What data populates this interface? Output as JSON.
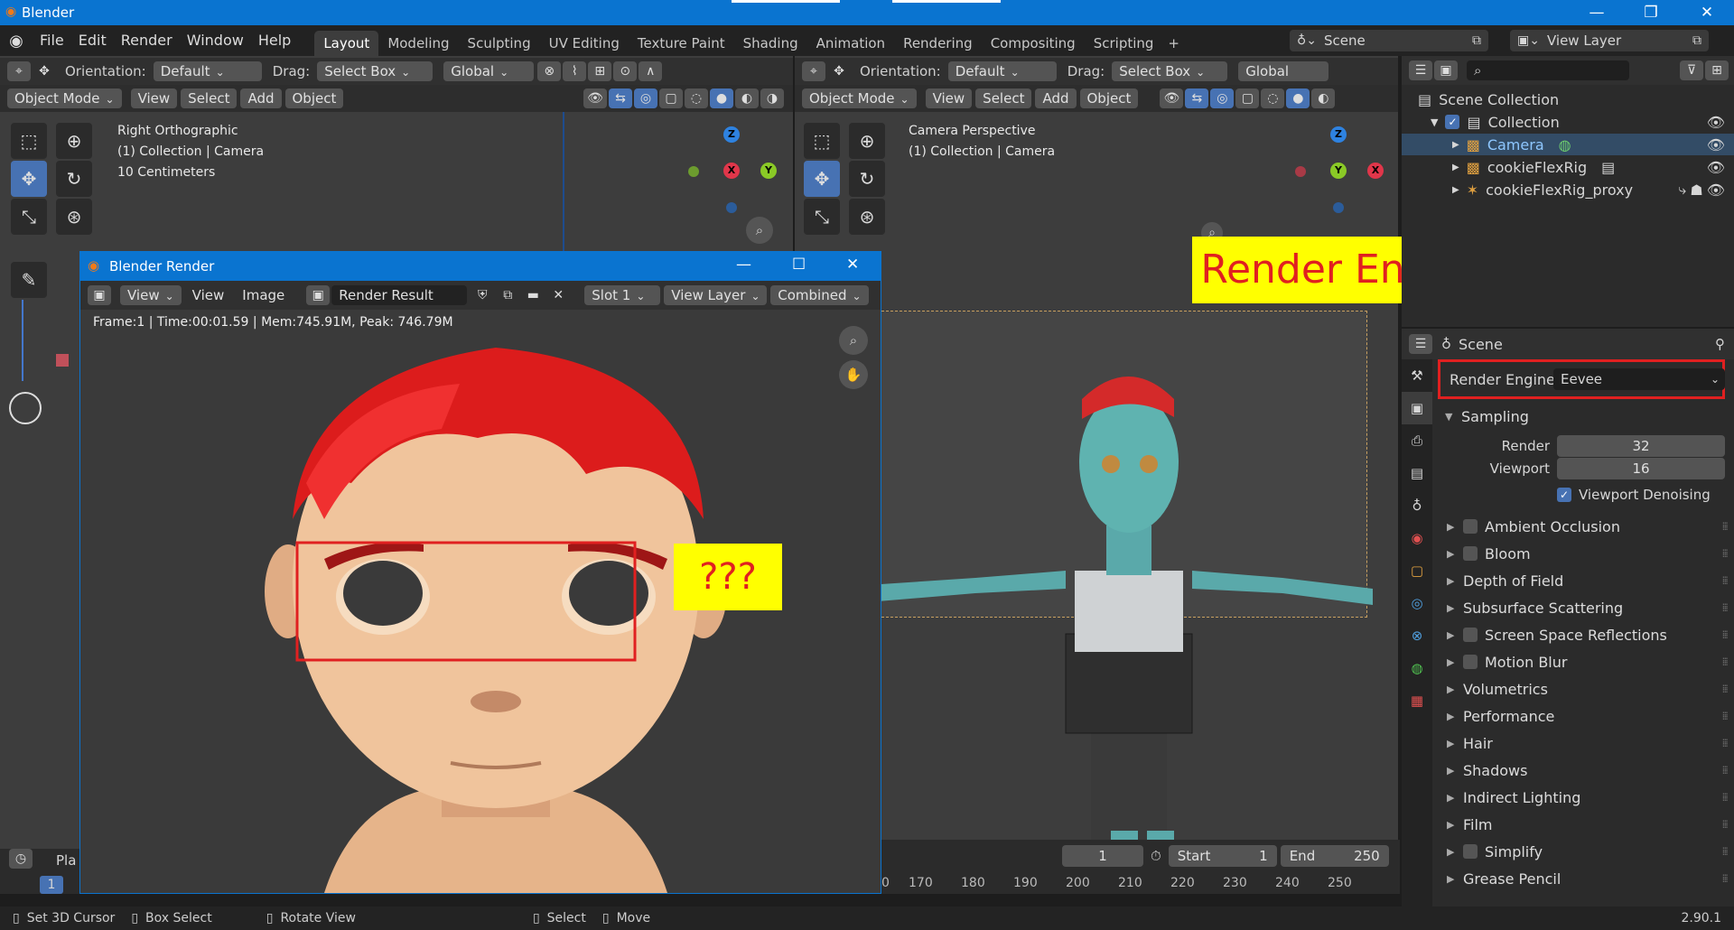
{
  "app": {
    "title": "Blender",
    "version": "2.90.1"
  },
  "menu": [
    "File",
    "Edit",
    "Render",
    "Window",
    "Help"
  ],
  "workspaces": [
    "Layout",
    "Modeling",
    "Sculpting",
    "UV Editing",
    "Texture Paint",
    "Shading",
    "Animation",
    "Rendering",
    "Compositing",
    "Scripting"
  ],
  "top_right": {
    "scene": "Scene",
    "view_layer": "View Layer"
  },
  "viewport_header": {
    "orientation_label": "Orientation:",
    "orientation_value": "Default",
    "drag_label": "Drag:",
    "drag_value": "Select Box",
    "transform": "Global",
    "mode": "Object Mode",
    "menus": [
      "View",
      "Select",
      "Add",
      "Object"
    ]
  },
  "left_viewport": {
    "lines": [
      "Right Orthographic",
      "(1) Collection | Camera",
      "10 Centimeters"
    ]
  },
  "right_viewport": {
    "lines": [
      "Camera Perspective",
      "(1) Collection | Camera"
    ]
  },
  "annotation_engine": "Render Engine: Eevee",
  "annotation_question": "???",
  "render_window": {
    "title": "Blender Render",
    "menus": [
      "View",
      "View",
      "Image"
    ],
    "image_name": "Render Result",
    "slot": "Slot 1",
    "layer": "View Layer",
    "pass": "Combined",
    "info": "Frame:1 | Time:00:01.59 | Mem:745.91M, Peak: 746.79M"
  },
  "outliner": {
    "root": "Scene Collection",
    "collection": "Collection",
    "items": [
      "Camera",
      "cookieFlexRig",
      "cookieFlexRig_proxy"
    ]
  },
  "properties": {
    "context": "Scene",
    "render_engine_label": "Render Engine",
    "render_engine_value": "Eevee",
    "sampling": "Sampling",
    "render_label": "Render",
    "render_samples": "32",
    "viewport_label": "Viewport",
    "viewport_samples": "16",
    "denoise_label": "Viewport Denoising",
    "panels": [
      {
        "label": "Ambient Occlusion",
        "checkbox": true
      },
      {
        "label": "Bloom",
        "checkbox": true
      },
      {
        "label": "Depth of Field",
        "checkbox": false
      },
      {
        "label": "Subsurface Scattering",
        "checkbox": false
      },
      {
        "label": "Screen Space Reflections",
        "checkbox": true
      },
      {
        "label": "Motion Blur",
        "checkbox": true
      },
      {
        "label": "Volumetrics",
        "checkbox": false
      },
      {
        "label": "Performance",
        "checkbox": false
      },
      {
        "label": "Hair",
        "checkbox": false
      },
      {
        "label": "Shadows",
        "checkbox": false
      },
      {
        "label": "Indirect Lighting",
        "checkbox": false
      },
      {
        "label": "Film",
        "checkbox": false
      },
      {
        "label": "Simplify",
        "checkbox": true
      },
      {
        "label": "Grease Pencil",
        "checkbox": false
      }
    ]
  },
  "timeline": {
    "current_frame": "1",
    "start_label": "Start",
    "start": "1",
    "end_label": "End",
    "end": "250",
    "ticks": [
      "0",
      "170",
      "180",
      "190",
      "200",
      "210",
      "220",
      "230",
      "240",
      "250"
    ],
    "left_frame": "1",
    "left_label": "Pla"
  },
  "status": {
    "items": [
      "Set 3D Cursor",
      "Box Select",
      "Rotate View",
      "Select",
      "Move"
    ]
  }
}
